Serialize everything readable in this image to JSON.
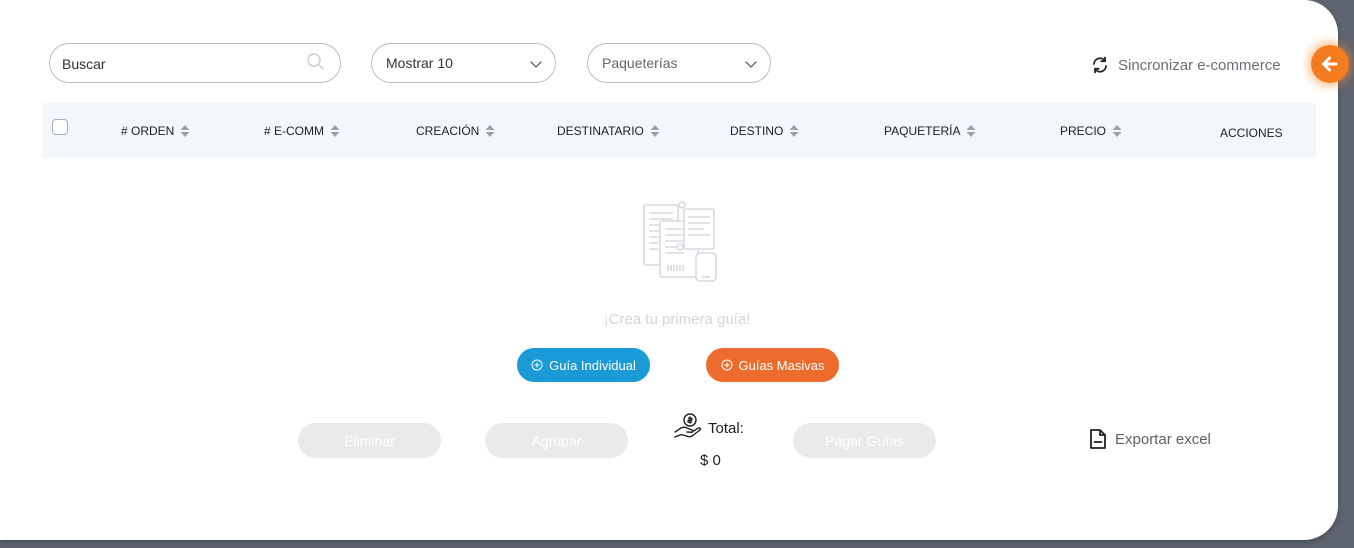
{
  "toolbar": {
    "search_placeholder": "Buscar",
    "show_select_value": "Mostrar 10",
    "carrier_select_value": "Paqueterías",
    "sync_label": "Sincronizar e-commerce"
  },
  "table": {
    "columns": [
      "# ORDEN",
      "# E-COMM",
      "CREACIÓN",
      "DESTINATARIO",
      "DESTINO",
      "PAQUETERÍA",
      "PRECIO",
      "ACCIONES"
    ]
  },
  "empty_state": {
    "message": "¡Crea tu primera guía!",
    "individual_button": "Guía Individual",
    "bulk_button": "Guías Masivas"
  },
  "footer": {
    "delete_button": "Eliminar",
    "group_button": "Agrupar",
    "pay_button": "Pagar Guías",
    "total_label": "Total:",
    "total_value": "$ 0",
    "export_label": "Exportar excel"
  },
  "colors": {
    "accent_orange": "#f47b20",
    "primary_blue": "#1a9bd7",
    "secondary_orange": "#ec6b2d",
    "header_bg": "#f2f7fc"
  },
  "icons": {
    "search": "search-icon",
    "chevron": "chevron-down-icon",
    "sync": "sync-icon",
    "back": "arrow-left-icon",
    "sort": "sort-icon",
    "empty": "documents-illustration-icon",
    "add": "plus-circle-icon",
    "money": "money-hand-icon",
    "export": "file-icon"
  }
}
